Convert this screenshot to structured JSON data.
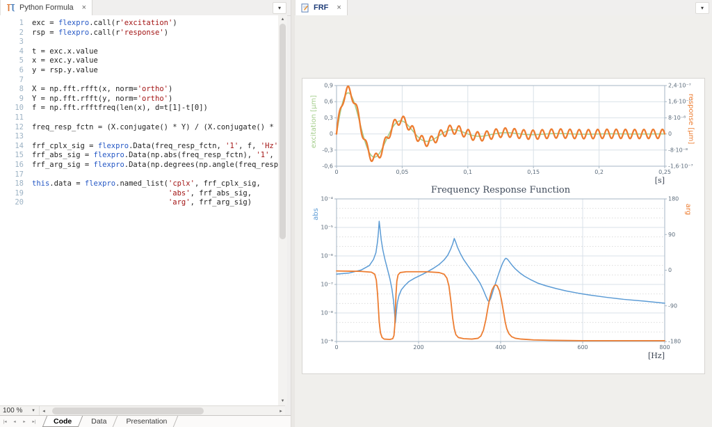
{
  "left_panel": {
    "tab": {
      "title": "Python Formula",
      "close": "×"
    },
    "dropdown_icon": "▾",
    "editor": {
      "lines": [
        {
          "n": "1",
          "t": [
            [
              "d",
              "exc = "
            ],
            [
              "k",
              "flexpro"
            ],
            [
              "d",
              ".call(r"
            ],
            [
              "s",
              "'excitation'"
            ],
            [
              "d",
              ")"
            ]
          ]
        },
        {
          "n": "2",
          "t": [
            [
              "d",
              "rsp = "
            ],
            [
              "k",
              "flexpro"
            ],
            [
              "d",
              ".call(r"
            ],
            [
              "s",
              "'response'"
            ],
            [
              "d",
              ")"
            ]
          ]
        },
        {
          "n": "3",
          "t": []
        },
        {
          "n": "4",
          "t": [
            [
              "d",
              "t = exc.x.value"
            ]
          ]
        },
        {
          "n": "5",
          "t": [
            [
              "d",
              "x = exc.y.value"
            ]
          ]
        },
        {
          "n": "6",
          "t": [
            [
              "d",
              "y = rsp.y.value"
            ]
          ]
        },
        {
          "n": "7",
          "t": []
        },
        {
          "n": "8",
          "t": [
            [
              "d",
              "X = np.fft.rfft(x, norm="
            ],
            [
              "s",
              "'ortho'"
            ],
            [
              "d",
              ")"
            ]
          ]
        },
        {
          "n": "9",
          "t": [
            [
              "d",
              "Y = np.fft.rfft(y, norm="
            ],
            [
              "s",
              "'ortho'"
            ],
            [
              "d",
              ")"
            ]
          ]
        },
        {
          "n": "10",
          "t": [
            [
              "d",
              "f = np.fft.rfftfreq(len(x), d=t[1]-t[0])"
            ]
          ]
        },
        {
          "n": "11",
          "t": []
        },
        {
          "n": "12",
          "t": [
            [
              "d",
              "freq_resp_fctn = (X.conjugate() * Y) / (X.conjugate() *"
            ]
          ]
        },
        {
          "n": "13",
          "t": []
        },
        {
          "n": "14",
          "t": [
            [
              "d",
              "frf_cplx_sig = "
            ],
            [
              "k",
              "flexpro"
            ],
            [
              "d",
              ".Data(freq_resp_fctn, "
            ],
            [
              "s",
              "'1'"
            ],
            [
              "d",
              ", f, "
            ],
            [
              "s",
              "'Hz'"
            ]
          ]
        },
        {
          "n": "15",
          "t": [
            [
              "d",
              "frf_abs_sig = "
            ],
            [
              "k",
              "flexpro"
            ],
            [
              "d",
              ".Data(np.abs(freq_resp_fctn), "
            ],
            [
              "s",
              "'1'"
            ],
            [
              "d",
              ","
            ]
          ]
        },
        {
          "n": "16",
          "t": [
            [
              "d",
              "frf_arg_sig = "
            ],
            [
              "k",
              "flexpro"
            ],
            [
              "d",
              ".Data(np.degrees(np.angle(freq_resp"
            ]
          ]
        },
        {
          "n": "17",
          "t": []
        },
        {
          "n": "18",
          "t": [
            [
              "k",
              "this"
            ],
            [
              "d",
              ".data = "
            ],
            [
              "k",
              "flexpro"
            ],
            [
              "d",
              ".named_list("
            ],
            [
              "s",
              "'cplx'"
            ],
            [
              "d",
              ", frf_cplx_sig,"
            ]
          ]
        },
        {
          "n": "19",
          "t": [
            [
              "d",
              "                               "
            ],
            [
              "s",
              "'abs'"
            ],
            [
              "d",
              ", frf_abs_sig,"
            ]
          ]
        },
        {
          "n": "20",
          "t": [
            [
              "d",
              "                               "
            ],
            [
              "s",
              "'arg'"
            ],
            [
              "d",
              ", frf_arg_sig)"
            ]
          ]
        }
      ]
    },
    "zoom_control": {
      "value": "100 %",
      "dropdown": "▾"
    },
    "scroll_icons": {
      "up": "▴",
      "down": "▾",
      "left": "◂",
      "right": "▸"
    },
    "sheet_nav": [
      "|◂",
      "◂",
      "▸",
      "▸|"
    ],
    "sheet_tabs": [
      {
        "label": "Code",
        "active": true
      },
      {
        "label": "Data",
        "active": false
      },
      {
        "label": "Presentation",
        "active": false
      }
    ]
  },
  "right_panel": {
    "tab": {
      "title": "FRF",
      "close": "×"
    },
    "dropdown_icon": "▾"
  },
  "colors": {
    "excitation_green": "#a5ce8c",
    "response_orange": "#ed7d31",
    "abs_blue": "#5b9bd5",
    "grid": "#d9e1e8",
    "axis": "#a6b6c4",
    "minor_grid": "#dcdcdc",
    "tick_text": "#5b6b7b"
  },
  "chart_data": [
    {
      "type": "line",
      "title": "",
      "x_axis": {
        "label": "[s]",
        "min": 0,
        "max": 0.25,
        "ticks": [
          "0",
          "0,05",
          "0,1",
          "0,15",
          "0,2",
          "0,25"
        ]
      },
      "y_left": {
        "label": "excitation [µm]",
        "min": -0.6,
        "max": 0.9,
        "ticks": [
          "0,9",
          "0,6",
          "0,3",
          "0",
          "-0,3",
          "-0,6"
        ]
      },
      "y_right": {
        "label": "response [µm]",
        "ticks": [
          "2,4·10⁻⁷",
          "1,6·10⁻⁷",
          "8·10⁻⁸",
          "0",
          "-8·10⁻⁸",
          "-1,6·10⁻⁷"
        ]
      },
      "series": [
        {
          "name": "excitation",
          "width": 1.6,
          "gen": {
            "kind": "damped_sine",
            "amp": 1.0,
            "freq": 25,
            "tau": 0.035
          }
        },
        {
          "name": "response",
          "width": 2.3,
          "gen": {
            "kind": "scaled_plus_ripple",
            "scale": 1.05,
            "ripple_amp": 0.085,
            "ripple_freq": 142
          }
        }
      ]
    },
    {
      "type": "line",
      "title": "Frequency Response Function",
      "x_axis": {
        "label": "[Hz]",
        "min": 0,
        "max": 800,
        "ticks": [
          "0",
          "200",
          "400",
          "600",
          "800"
        ]
      },
      "y_left": {
        "label": "abs",
        "scale": "log",
        "exp_top": -4,
        "exp_bottom": -9,
        "ticks": [
          "10⁻⁴",
          "10⁻⁵",
          "10⁻⁶",
          "10⁻⁷",
          "10⁻⁸",
          "10⁻⁹"
        ]
      },
      "y_right": {
        "label": "arg",
        "min": -180,
        "max": 180,
        "ticks": [
          "180",
          "90",
          "0",
          "-90",
          "-180"
        ]
      },
      "series": [
        {
          "name": "abs",
          "axis": "left",
          "points": [
            [
              0,
              2.3e-07
            ],
            [
              30,
              2.5e-07
            ],
            [
              60,
              3.2e-07
            ],
            [
              80,
              4.6e-07
            ],
            [
              90,
              7.5e-07
            ],
            [
              96,
              1.3e-06
            ],
            [
              100,
              3.2e-06
            ],
            [
              102,
              6.5e-06
            ],
            [
              104,
              1.65e-05
            ],
            [
              106,
              9e-06
            ],
            [
              109,
              3.6e-06
            ],
            [
              113,
              1.6e-06
            ],
            [
              118,
              7.5e-07
            ],
            [
              124,
              3.5e-07
            ],
            [
              130,
              1.6e-07
            ],
            [
              135,
              7e-08
            ],
            [
              139,
              2.6e-08
            ],
            [
              142,
              8e-09
            ],
            [
              143.5,
              4.5e-09
            ],
            [
              145,
              8e-09
            ],
            [
              148,
              2.2e-08
            ],
            [
              152,
              4e-08
            ],
            [
              158,
              6.5e-08
            ],
            [
              166,
              9e-08
            ],
            [
              176,
              1.25e-07
            ],
            [
              190,
              1.65e-07
            ],
            [
              205,
              2.1e-07
            ],
            [
              220,
              2.7e-07
            ],
            [
              235,
              3.6e-07
            ],
            [
              250,
              5e-07
            ],
            [
              262,
              7.2e-07
            ],
            [
              271,
              1.05e-06
            ],
            [
              278,
              1.7e-06
            ],
            [
              283,
              2.6e-06
            ],
            [
              287,
              4.1e-06
            ],
            [
              290,
              3.2e-06
            ],
            [
              295,
              2e-06
            ],
            [
              302,
              1.2e-06
            ],
            [
              310,
              7.4e-07
            ],
            [
              320,
              4.6e-07
            ],
            [
              330,
              2.9e-07
            ],
            [
              340,
              1.85e-07
            ],
            [
              350,
              1.1e-07
            ],
            [
              358,
              6.3e-08
            ],
            [
              364,
              3.9e-08
            ],
            [
              369,
              2.7e-08
            ],
            [
              372,
              2.5e-08
            ],
            [
              376,
              3.3e-08
            ],
            [
              381,
              5.6e-08
            ],
            [
              387,
              1.05e-07
            ],
            [
              393,
              1.9e-07
            ],
            [
              399,
              3.4e-07
            ],
            [
              405,
              5.6e-07
            ],
            [
              410,
              7.6e-07
            ],
            [
              413,
              8.3e-07
            ],
            [
              417,
              7.6e-07
            ],
            [
              422,
              6.1e-07
            ],
            [
              428,
              4.7e-07
            ],
            [
              436,
              3.5e-07
            ],
            [
              446,
              2.6e-07
            ],
            [
              458,
              1.95e-07
            ],
            [
              472,
              1.5e-07
            ],
            [
              490,
              1.12e-07
            ],
            [
              510,
              9e-08
            ],
            [
              535,
              7.2e-08
            ],
            [
              560,
              5.9e-08
            ],
            [
              590,
              4.9e-08
            ],
            [
              620,
              4.2e-08
            ],
            [
              660,
              3.5e-08
            ],
            [
              700,
              3e-08
            ],
            [
              750,
              2.6e-08
            ],
            [
              800,
              2.2e-08
            ]
          ]
        },
        {
          "name": "arg",
          "axis": "right",
          "points": [
            [
              0,
              -2
            ],
            [
              60,
              -3
            ],
            [
              85,
              -5
            ],
            [
              93,
              -10
            ],
            [
              97,
              -25
            ],
            [
              100,
              -60
            ],
            [
              102,
              -95
            ],
            [
              104,
              -130
            ],
            [
              107,
              -158
            ],
            [
              111,
              -170
            ],
            [
              116,
              -174
            ],
            [
              130,
              -175
            ],
            [
              137,
              -173
            ],
            [
              140,
              -165
            ],
            [
              142,
              -140
            ],
            [
              143.5,
              -100
            ],
            [
              145,
              -60
            ],
            [
              147,
              -28
            ],
            [
              150,
              -12
            ],
            [
              155,
              -6
            ],
            [
              170,
              -4
            ],
            [
              220,
              -4
            ],
            [
              250,
              -6
            ],
            [
              262,
              -10
            ],
            [
              269,
              -20
            ],
            [
              274,
              -40
            ],
            [
              279,
              -80
            ],
            [
              283,
              -120
            ],
            [
              287,
              -148
            ],
            [
              291,
              -163
            ],
            [
              297,
              -170
            ],
            [
              310,
              -173
            ],
            [
              330,
              -174
            ],
            [
              345,
              -172
            ],
            [
              352,
              -166
            ],
            [
              358,
              -152
            ],
            [
              364,
              -125
            ],
            [
              369,
              -95
            ],
            [
              374,
              -68
            ],
            [
              379,
              -50
            ],
            [
              384,
              -40
            ],
            [
              388,
              -37
            ],
            [
              392,
              -40
            ],
            [
              397,
              -52
            ],
            [
              402,
              -75
            ],
            [
              407,
              -105
            ],
            [
              411,
              -130
            ],
            [
              415,
              -148
            ],
            [
              420,
              -160
            ],
            [
              427,
              -168
            ],
            [
              436,
              -172
            ],
            [
              450,
              -174
            ],
            [
              480,
              -176
            ],
            [
              520,
              -177
            ],
            [
              600,
              -178
            ],
            [
              700,
              -178
            ],
            [
              800,
              -178
            ]
          ]
        }
      ]
    }
  ]
}
